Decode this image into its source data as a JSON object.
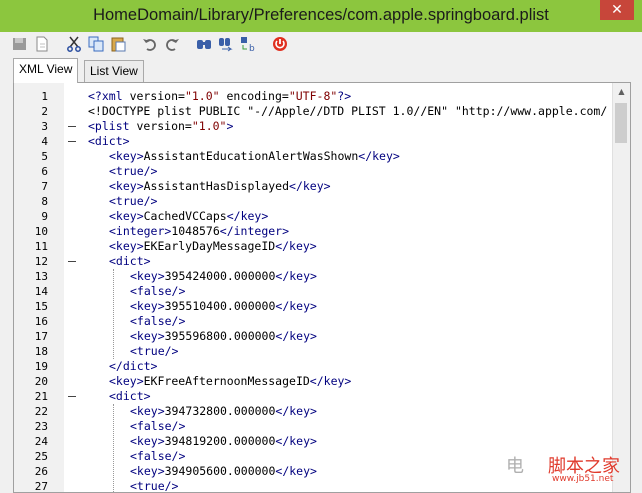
{
  "window": {
    "title": "HomeDomain/Library/Preferences/com.apple.springboard.plist",
    "close_glyph": "✕"
  },
  "toolbar": {
    "buttons": [
      "save-icon",
      "new-document-icon",
      "cut-icon",
      "copy-icon",
      "paste-icon",
      "undo-icon",
      "redo-icon",
      "find-icon",
      "find-next-icon",
      "replace-icon",
      "power-icon"
    ]
  },
  "tabs": [
    {
      "label": "XML View",
      "active": true
    },
    {
      "label": "List View",
      "active": false
    }
  ],
  "editor": {
    "lines": [
      {
        "n": "1",
        "fold": "",
        "indent": 0,
        "segments": [
          [
            "t",
            "<?"
          ],
          [
            "t",
            "xml"
          ],
          [
            "an",
            " version="
          ],
          [
            "at",
            "\"1.0\""
          ],
          [
            "an",
            " encoding="
          ],
          [
            "at",
            "\"UTF-8\""
          ],
          [
            "t",
            "?>"
          ]
        ]
      },
      {
        "n": "2",
        "fold": "",
        "indent": 0,
        "segments": [
          [
            "tx",
            "<!DOCTYPE plist PUBLIC \"-//Apple//DTD PLIST 1.0//EN\" \"http://www.apple.com/"
          ]
        ]
      },
      {
        "n": "3",
        "fold": "-",
        "indent": 0,
        "segments": [
          [
            "t",
            "<plist"
          ],
          [
            "an",
            " version="
          ],
          [
            "at",
            "\"1.0\""
          ],
          [
            "t",
            ">"
          ]
        ]
      },
      {
        "n": "4",
        "fold": "-",
        "indent": 0,
        "segments": [
          [
            "t",
            "<dict>"
          ]
        ]
      },
      {
        "n": "5",
        "fold": "",
        "indent": 1,
        "segments": [
          [
            "t",
            "<key>"
          ],
          [
            "tx",
            "AssistantEducationAlertWasShown"
          ],
          [
            "t",
            "</key>"
          ]
        ]
      },
      {
        "n": "6",
        "fold": "",
        "indent": 1,
        "segments": [
          [
            "t",
            "<true/>"
          ]
        ]
      },
      {
        "n": "7",
        "fold": "",
        "indent": 1,
        "segments": [
          [
            "t",
            "<key>"
          ],
          [
            "tx",
            "AssistantHasDisplayed"
          ],
          [
            "t",
            "</key>"
          ]
        ]
      },
      {
        "n": "8",
        "fold": "",
        "indent": 1,
        "segments": [
          [
            "t",
            "<true/>"
          ]
        ]
      },
      {
        "n": "9",
        "fold": "",
        "indent": 1,
        "segments": [
          [
            "t",
            "<key>"
          ],
          [
            "tx",
            "CachedVCCaps"
          ],
          [
            "t",
            "</key>"
          ]
        ]
      },
      {
        "n": "10",
        "fold": "",
        "indent": 1,
        "segments": [
          [
            "t",
            "<integer>"
          ],
          [
            "tx",
            "1048576"
          ],
          [
            "t",
            "</integer>"
          ]
        ]
      },
      {
        "n": "11",
        "fold": "",
        "indent": 1,
        "segments": [
          [
            "t",
            "<key>"
          ],
          [
            "tx",
            "EKEarlyDayMessageID"
          ],
          [
            "t",
            "</key>"
          ]
        ]
      },
      {
        "n": "12",
        "fold": "-",
        "indent": 1,
        "segments": [
          [
            "t",
            "<dict>"
          ]
        ]
      },
      {
        "n": "13",
        "fold": "",
        "indent": 2,
        "segments": [
          [
            "t",
            "<key>"
          ],
          [
            "tx",
            "395424000.000000"
          ],
          [
            "t",
            "</key>"
          ]
        ]
      },
      {
        "n": "14",
        "fold": "",
        "indent": 2,
        "segments": [
          [
            "t",
            "<false/>"
          ]
        ]
      },
      {
        "n": "15",
        "fold": "",
        "indent": 2,
        "segments": [
          [
            "t",
            "<key>"
          ],
          [
            "tx",
            "395510400.000000"
          ],
          [
            "t",
            "</key>"
          ]
        ]
      },
      {
        "n": "16",
        "fold": "",
        "indent": 2,
        "segments": [
          [
            "t",
            "<false/>"
          ]
        ]
      },
      {
        "n": "17",
        "fold": "",
        "indent": 2,
        "segments": [
          [
            "t",
            "<key>"
          ],
          [
            "tx",
            "395596800.000000"
          ],
          [
            "t",
            "</key>"
          ]
        ]
      },
      {
        "n": "18",
        "fold": "",
        "indent": 2,
        "segments": [
          [
            "t",
            "<true/>"
          ]
        ]
      },
      {
        "n": "19",
        "fold": "",
        "indent": 1,
        "segments": [
          [
            "t",
            "</dict>"
          ]
        ]
      },
      {
        "n": "20",
        "fold": "",
        "indent": 1,
        "segments": [
          [
            "t",
            "<key>"
          ],
          [
            "tx",
            "EKFreeAfternoonMessageID"
          ],
          [
            "t",
            "</key>"
          ]
        ]
      },
      {
        "n": "21",
        "fold": "-",
        "indent": 1,
        "segments": [
          [
            "t",
            "<dict>"
          ]
        ]
      },
      {
        "n": "22",
        "fold": "",
        "indent": 2,
        "segments": [
          [
            "t",
            "<key>"
          ],
          [
            "tx",
            "394732800.000000"
          ],
          [
            "t",
            "</key>"
          ]
        ]
      },
      {
        "n": "23",
        "fold": "",
        "indent": 2,
        "segments": [
          [
            "t",
            "<false/>"
          ]
        ]
      },
      {
        "n": "24",
        "fold": "",
        "indent": 2,
        "segments": [
          [
            "t",
            "<key>"
          ],
          [
            "tx",
            "394819200.000000"
          ],
          [
            "t",
            "</key>"
          ]
        ]
      },
      {
        "n": "25",
        "fold": "",
        "indent": 2,
        "segments": [
          [
            "t",
            "<false/>"
          ]
        ]
      },
      {
        "n": "26",
        "fold": "",
        "indent": 2,
        "segments": [
          [
            "t",
            "<key>"
          ],
          [
            "tx",
            "394905600.000000"
          ],
          [
            "t",
            "</key>"
          ]
        ]
      },
      {
        "n": "27",
        "fold": "",
        "indent": 2,
        "segments": [
          [
            "t",
            "<true/>"
          ]
        ]
      }
    ]
  },
  "watermark": {
    "text": "脚本之家",
    "url": "www.jb51.net",
    "logo": "电"
  },
  "colors": {
    "titlebar": "#8cc63e",
    "tag": "#00007f",
    "attr_value": "#7f0000"
  }
}
